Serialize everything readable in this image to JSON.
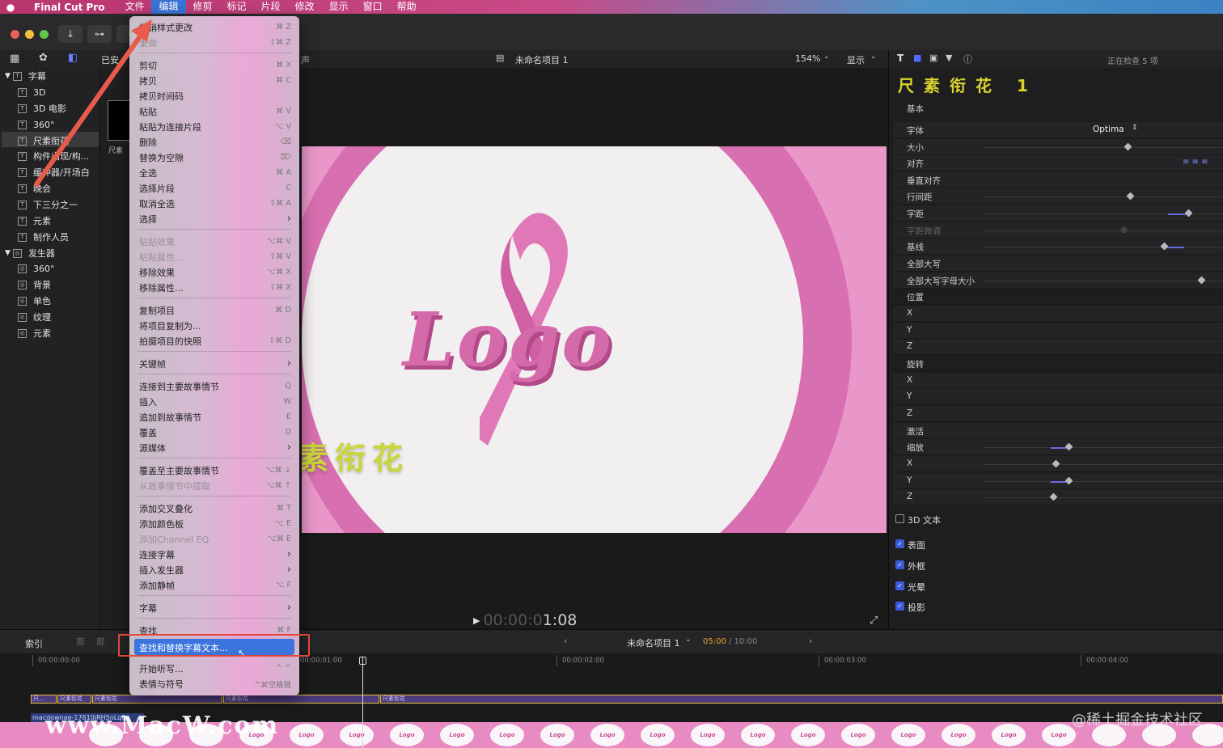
{
  "menubar": {
    "app_name": "Final Cut Pro",
    "items": [
      "文件",
      "编辑",
      "修剪",
      "标记",
      "片段",
      "修改",
      "显示",
      "窗口",
      "帮助"
    ],
    "active_index": 1
  },
  "sidebar": {
    "items": [
      {
        "label": "字幕",
        "level": 0,
        "expanded": true
      },
      {
        "label": "3D",
        "level": 1
      },
      {
        "label": "3D 电影",
        "level": 1
      },
      {
        "label": "360°",
        "level": 1
      },
      {
        "label": "尺素衔花",
        "level": 1,
        "selected": true
      },
      {
        "label": "构件出现/构...",
        "level": 1
      },
      {
        "label": "缓冲器/开场白",
        "level": 1
      },
      {
        "label": "晚会",
        "level": 1
      },
      {
        "label": "下三分之一",
        "level": 1
      },
      {
        "label": "元素",
        "level": 1
      },
      {
        "label": "制作人员",
        "level": 1
      },
      {
        "label": "发生器",
        "level": 0,
        "expanded": true
      },
      {
        "label": "360°",
        "level": 1
      },
      {
        "label": "背景",
        "level": 1
      },
      {
        "label": "单色",
        "level": 1
      },
      {
        "label": "纹理",
        "level": 1
      },
      {
        "label": "元素",
        "level": 1
      }
    ],
    "header_partial": "已安",
    "thumb_label": "尺素"
  },
  "viewer": {
    "project_title": "未命名项目 1",
    "zoom": "154%",
    "display_label": "显示",
    "hdr_partial": "声",
    "logo_text": "Logo",
    "caption": "素衔花",
    "timecode_dim": "00:00:0",
    "timecode_bright": "1:08"
  },
  "inspector": {
    "inspecting": "正在检查 5 项",
    "title": "尺素衔花 1",
    "section_basic": "基本",
    "font_label": "字体",
    "font_value": "Optima",
    "rows": [
      "大小",
      "对齐",
      "垂直对齐",
      "行间距",
      "字距",
      "字距微调",
      "基线",
      "全部大写",
      "全部大写字母大小",
      "位置",
      "X",
      "Y",
      "Z",
      "旋转",
      "X",
      "Y",
      "Z",
      "激活",
      "缩放",
      "X",
      "Y",
      "Z"
    ],
    "text3d": "3D 文本",
    "checks": [
      "表面",
      "外框",
      "光晕",
      "投影"
    ]
  },
  "menu": {
    "items": [
      {
        "label": "撤销样式更改",
        "key": "⌘ Z"
      },
      {
        "label": "重做",
        "key": "⇧⌘ Z",
        "disabled": true
      },
      {
        "sep": true
      },
      {
        "label": "剪切",
        "key": "⌘ X"
      },
      {
        "label": "拷贝",
        "key": "⌘ C"
      },
      {
        "label": "拷贝时间码",
        "key": ""
      },
      {
        "label": "粘贴",
        "key": "⌘ V"
      },
      {
        "label": "粘贴为连接片段",
        "key": "⌥ V"
      },
      {
        "label": "删除",
        "key": "⌫"
      },
      {
        "label": "替换为空隙",
        "key": "⌦"
      },
      {
        "label": "全选",
        "key": "⌘ A"
      },
      {
        "label": "选择片段",
        "key": "C"
      },
      {
        "label": "取消全选",
        "key": "⇧⌘ A"
      },
      {
        "label": "选择",
        "key": "›"
      },
      {
        "sep": true
      },
      {
        "label": "粘贴效果",
        "key": "⌥⌘ V",
        "disabled": true
      },
      {
        "label": "粘贴属性...",
        "key": "⇧⌘ V",
        "disabled": true
      },
      {
        "label": "移除效果",
        "key": "⌥⌘ X"
      },
      {
        "label": "移除属性...",
        "key": "⇧⌘ X"
      },
      {
        "sep": true
      },
      {
        "label": "复制项目",
        "key": "⌘ D"
      },
      {
        "label": "将项目复制为...",
        "key": ""
      },
      {
        "label": "拍摄项目的快照",
        "key": "⇧⌘ D"
      },
      {
        "sep": true
      },
      {
        "label": "关键帧",
        "key": "›"
      },
      {
        "sep": true
      },
      {
        "label": "连接到主要故事情节",
        "key": "Q"
      },
      {
        "label": "插入",
        "key": "W"
      },
      {
        "label": "追加到故事情节",
        "key": "E"
      },
      {
        "label": "覆盖",
        "key": "D"
      },
      {
        "label": "源媒体",
        "key": "›"
      },
      {
        "sep": true
      },
      {
        "label": "覆盖至主要故事情节",
        "key": "⌥⌘ ↓"
      },
      {
        "label": "从故事情节中提取",
        "key": "⌥⌘ ↑",
        "disabled": true
      },
      {
        "sep": true
      },
      {
        "label": "添加交叉叠化",
        "key": "⌘ T"
      },
      {
        "label": "添加颜色板",
        "key": "⌥ E"
      },
      {
        "label": "添加Channel EQ",
        "key": "⌥⌘ E",
        "disabled": true
      },
      {
        "label": "连接字幕",
        "key": "›"
      },
      {
        "label": "插入发生器",
        "key": "›"
      },
      {
        "label": "添加静帧",
        "key": "⌥ F"
      },
      {
        "sep": true
      },
      {
        "label": "字幕",
        "key": "›"
      },
      {
        "sep": true
      },
      {
        "label": "查找",
        "key": "⌘ F"
      },
      {
        "label": "查找和替换字幕文本...",
        "key": "",
        "highlighted": true
      },
      {
        "sep": true
      },
      {
        "label": "开始听写...",
        "key": "^ ^"
      },
      {
        "label": "表情与符号",
        "key": "^⌘空格键"
      }
    ]
  },
  "timeline": {
    "index_label": "索引",
    "project": "未命名项目 1",
    "duration_current": "05:00",
    "duration_total": "/ 10:00",
    "ruler": [
      "00:00:00:00",
      "00:00:01:00",
      "00:00:02:00",
      "00:00:03:00",
      "00:00:04:00"
    ],
    "clip_label": "尺素衔花",
    "clip_short": "尺...",
    "media_label": "macdownae-17610jRH5nLq0",
    "film_label": "Logo"
  },
  "watermarks": {
    "left": "www.MacW.com",
    "right": "@稀土掘金技术社区"
  },
  "colors": {
    "accent_blue": "#3a74dc",
    "highlight_box": "#e2473b",
    "title_yellow": "#d9d52b",
    "pink": "#e996c9"
  }
}
